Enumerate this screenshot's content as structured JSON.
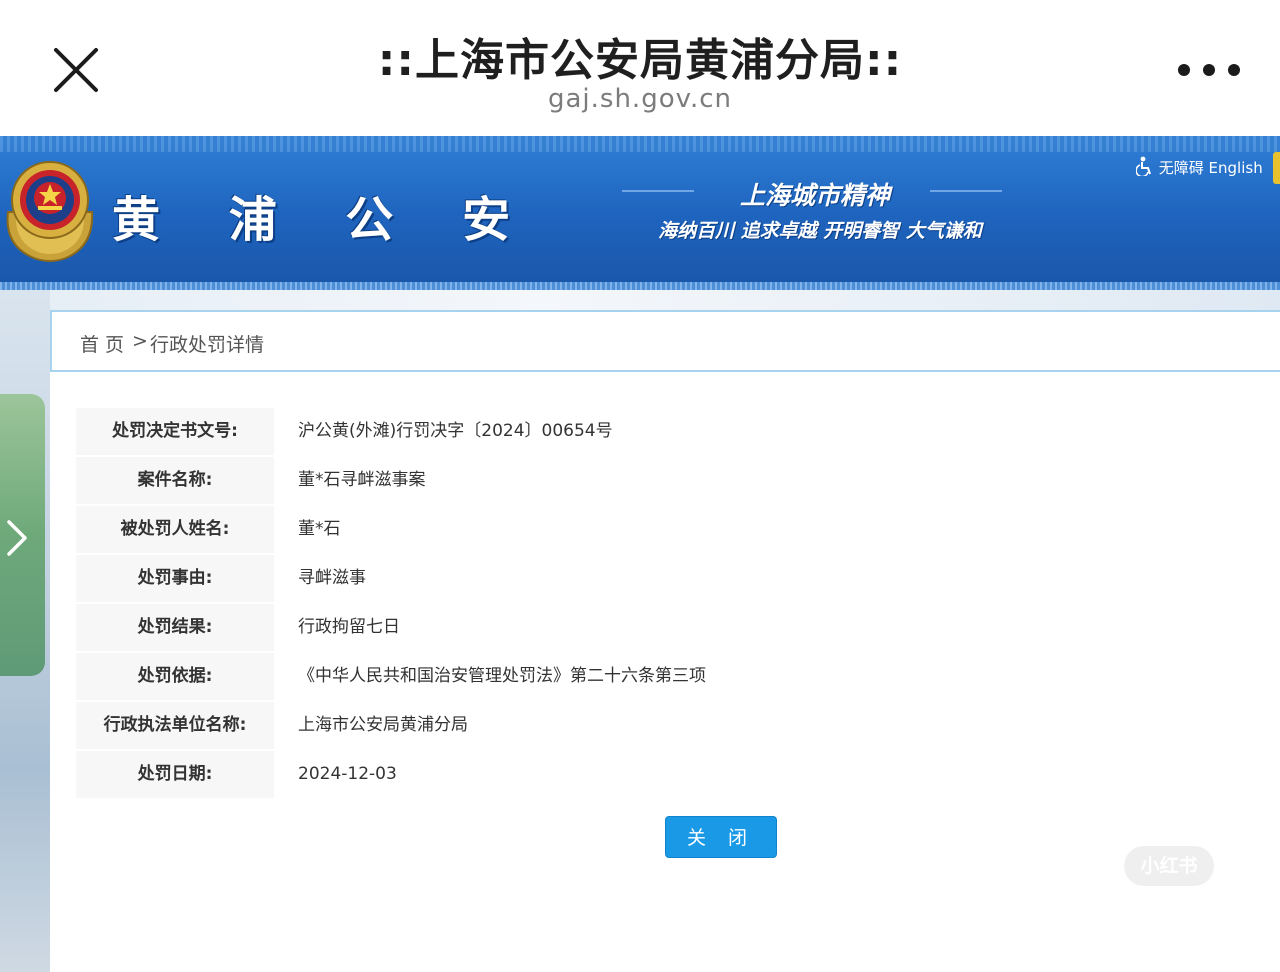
{
  "browser": {
    "title": "::上海市公安局黄浦分局::",
    "url": "gaj.sh.gov.cn"
  },
  "banner": {
    "brand": "黄 浦 公 安",
    "spirit_title": "上海城市精神",
    "spirit_subtitle": "海纳百川 追求卓越 开明睿智 大气谦和",
    "accessibility_link": "无障碍 English"
  },
  "breadcrumb": {
    "home": "首 页",
    "separator": ">",
    "current": "行政处罚详情"
  },
  "details": [
    {
      "label": "处罚决定书文号:",
      "value": "沪公黄(外滩)行罚决字〔2024〕00654号"
    },
    {
      "label": "案件名称:",
      "value": "董*石寻衅滋事案"
    },
    {
      "label": "被处罚人姓名:",
      "value": "董*石"
    },
    {
      "label": "处罚事由:",
      "value": "寻衅滋事"
    },
    {
      "label": "处罚结果:",
      "value": "行政拘留七日"
    },
    {
      "label": "处罚依据:",
      "value": "《中华人民共和国治安管理处罚法》第二十六条第三项"
    },
    {
      "label": "行政执法单位名称:",
      "value": "上海市公安局黄浦分局"
    },
    {
      "label": "处罚日期:",
      "value": "2024-12-03"
    }
  ],
  "actions": {
    "close_label": "关 闭"
  },
  "watermark": {
    "logo": "小红书"
  },
  "icons": {
    "close": "close-icon",
    "more": "more-icon",
    "emblem": "police-emblem-icon",
    "accessibility": "wheelchair-icon",
    "side_arrow": "chevron-right-icon"
  },
  "colors": {
    "banner_blue": "#1e63bd",
    "button_blue": "#1a9ae6",
    "breadcrumb_border": "#a8d3ee",
    "side_tab_green": "#6ea97a"
  }
}
